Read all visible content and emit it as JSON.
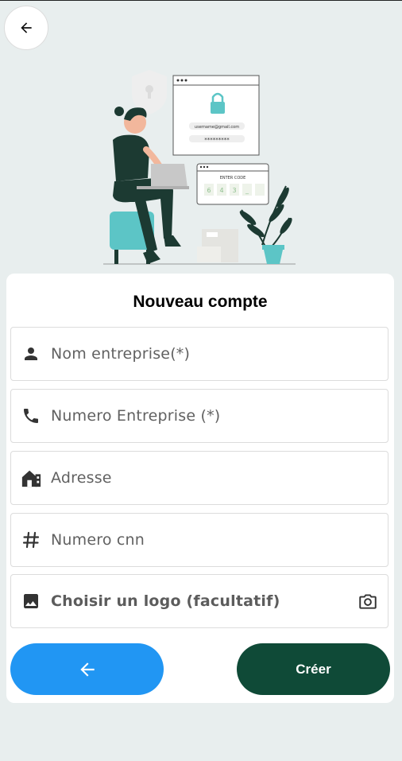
{
  "form": {
    "title": "Nouveau compte",
    "fields": [
      {
        "placeholder": "Nom entreprise(*)",
        "icon": "person-icon"
      },
      {
        "placeholder": "Numero Entreprise (*)",
        "icon": "phone-icon"
      },
      {
        "placeholder": "Adresse",
        "icon": "address-icon"
      },
      {
        "placeholder": "Numero cnn",
        "icon": "hash-icon"
      },
      {
        "placeholder": "Choisir un logo (facultatif)",
        "icon": "image-icon",
        "action_icon": "camera-icon"
      }
    ]
  },
  "illustration": {
    "email": "username@gmail.com",
    "password_mask": "*********",
    "code_label": "ENTER CODE",
    "code_digits": [
      "6",
      "4",
      "3",
      "_",
      ""
    ]
  },
  "buttons": {
    "create_label": "Créer",
    "back_icon": "arrow-left-icon"
  },
  "colors": {
    "background": "#e8eeee",
    "primary_blue": "#2196f3",
    "dark_green": "#0f4a37",
    "teal": "#5cc5c6"
  }
}
